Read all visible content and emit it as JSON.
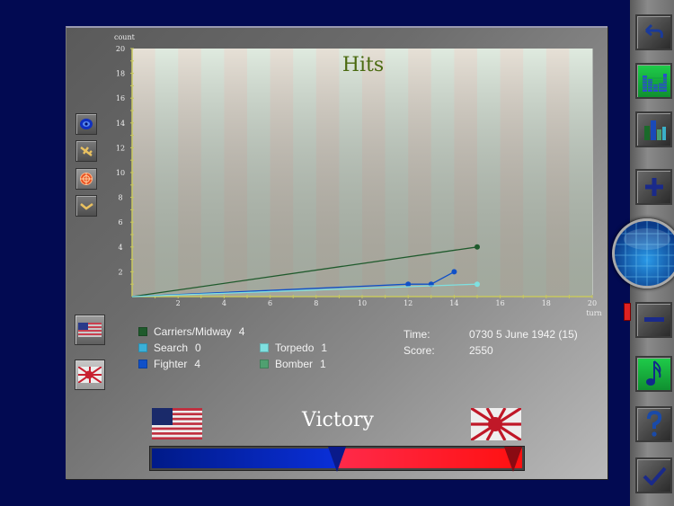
{
  "chart_data": {
    "type": "line",
    "title": "Hits",
    "xlabel": "turn",
    "ylabel": "count",
    "xlim": [
      0,
      20
    ],
    "ylim": [
      0,
      20
    ],
    "x_ticks": [
      2,
      4,
      6,
      8,
      10,
      12,
      14,
      16,
      18,
      20
    ],
    "y_ticks": [
      2,
      4,
      6,
      8,
      10,
      12,
      14,
      16,
      18,
      20
    ],
    "grid": false,
    "series": [
      {
        "name": "Carriers/Midway",
        "color": "#1f5a2c",
        "points": [
          [
            0,
            0
          ],
          [
            15,
            4
          ]
        ],
        "markers": [
          [
            15,
            4
          ]
        ]
      },
      {
        "name": "Search",
        "color": "#3ab0d8",
        "points": [
          [
            0,
            0
          ]
        ],
        "markers": []
      },
      {
        "name": "Fighter",
        "color": "#1050c8",
        "points": [
          [
            0,
            0
          ],
          [
            12,
            1
          ],
          [
            13,
            1
          ],
          [
            14,
            2
          ]
        ],
        "markers": [
          [
            12,
            1
          ],
          [
            13,
            1
          ],
          [
            14,
            2
          ]
        ]
      },
      {
        "name": "Torpedo",
        "color": "#7fe0e0",
        "points": [
          [
            0,
            0
          ],
          [
            15,
            1
          ]
        ],
        "markers": [
          [
            15,
            1
          ]
        ]
      },
      {
        "name": "Bomber",
        "color": "#4fa070",
        "points": [
          [
            0,
            0
          ]
        ],
        "markers": []
      }
    ]
  },
  "legend": [
    {
      "label": "Carriers/Midway",
      "value": "4",
      "color": "#1f5a2c"
    },
    {
      "label": "Search",
      "value": "0",
      "color": "#3ab0d8"
    },
    {
      "label": "Fighter",
      "value": "4",
      "color": "#1050c8"
    },
    {
      "label": "Torpedo",
      "value": "1",
      "color": "#7fe0e0"
    },
    {
      "label": "Bomber",
      "value": "1",
      "color": "#4fa070"
    }
  ],
  "info": {
    "time_label": "Time:",
    "time_value": "0730 5 June 1942 (15)",
    "score_label": "Score:",
    "score_value": "2550"
  },
  "victory": {
    "title": "Victory",
    "us_share": 0.5,
    "us_color": "#0a2fd8",
    "jp_color": "#ff1a30"
  },
  "left_filters": [
    {
      "icon": "eye-icon"
    },
    {
      "icon": "fighter-plane-icon"
    },
    {
      "icon": "crosshair-icon"
    },
    {
      "icon": "check-mark-icon"
    }
  ],
  "side_flags": [
    {
      "icon": "us-flag-icon"
    },
    {
      "icon": "japan-flag-icon"
    }
  ],
  "sidebar": [
    {
      "icon": "undo-icon",
      "style": "dark"
    },
    {
      "icon": "equalizer-icon",
      "style": "green"
    },
    {
      "icon": "bar-chart-icon",
      "style": "dark"
    },
    {
      "icon": "zoom-in-icon",
      "style": "dark"
    },
    {
      "icon": "zoom-out-icon",
      "style": "dark"
    },
    {
      "icon": "music-note-icon",
      "style": "green"
    },
    {
      "icon": "help-icon",
      "style": "dark"
    },
    {
      "icon": "confirm-icon",
      "style": "dark"
    }
  ]
}
